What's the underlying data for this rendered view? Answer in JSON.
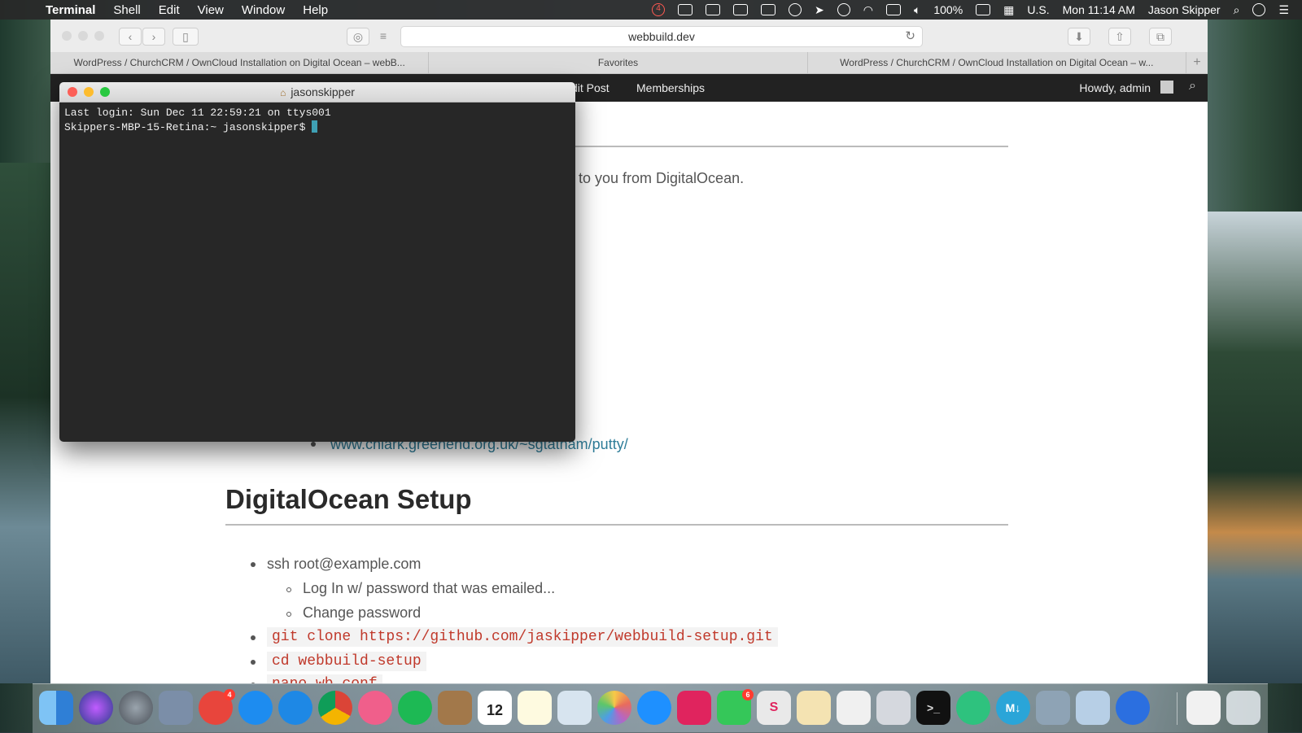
{
  "menubar": {
    "app": "Terminal",
    "items": [
      "Shell",
      "Edit",
      "View",
      "Window",
      "Help"
    ],
    "notification_count": "4",
    "battery": "100%",
    "input_source": "U.S.",
    "clock": "Mon 11:14 AM",
    "user": "Jason Skipper"
  },
  "safari": {
    "url": "webbuild.dev",
    "tabs": [
      "WordPress / ChurchCRM / OwnCloud Installation on Digital Ocean – webB...",
      "Favorites",
      "WordPress / ChurchCRM / OwnCloud Installation on Digital Ocean – w..."
    ],
    "new_tab": "+"
  },
  "wpbar": {
    "edit_post": "dit Post",
    "memberships": "Memberships",
    "howdy": "Howdy, admin"
  },
  "page": {
    "partial_text": "l to you from DigitalOcean.",
    "putty_link": "www.chiark.greenend.org.uk/~sgtatham/putty/",
    "section_title": "DigitalOcean Setup",
    "list": {
      "ssh": "ssh root@example.com",
      "login": "Log In w/ password that was emailed...",
      "change": "Change password",
      "git": "git clone https://github.com/jaskipper/webbuild-setup.git",
      "cd": "cd webbuild-setup",
      "nano": "nano wb.conf"
    }
  },
  "terminal": {
    "title": "jasonskipper",
    "line1": "Last login: Sun Dec 11 22:59:21 on ttys001",
    "prompt": "Skippers-MBP-15-Retina:~ jasonskipper$ "
  },
  "dock": {
    "mail_badge": "4",
    "facetime_badge": "6",
    "calendar_day": "12",
    "calendar_month": "DEC",
    "terminal_glyph": ">_",
    "markdown_glyph": "M↓",
    "slack_glyph": "S"
  },
  "colors": {
    "accent_link": "#2e7d99",
    "code_red": "#c0392b",
    "terminal_bg": "#272727",
    "cursor": "#3fa0b4"
  }
}
